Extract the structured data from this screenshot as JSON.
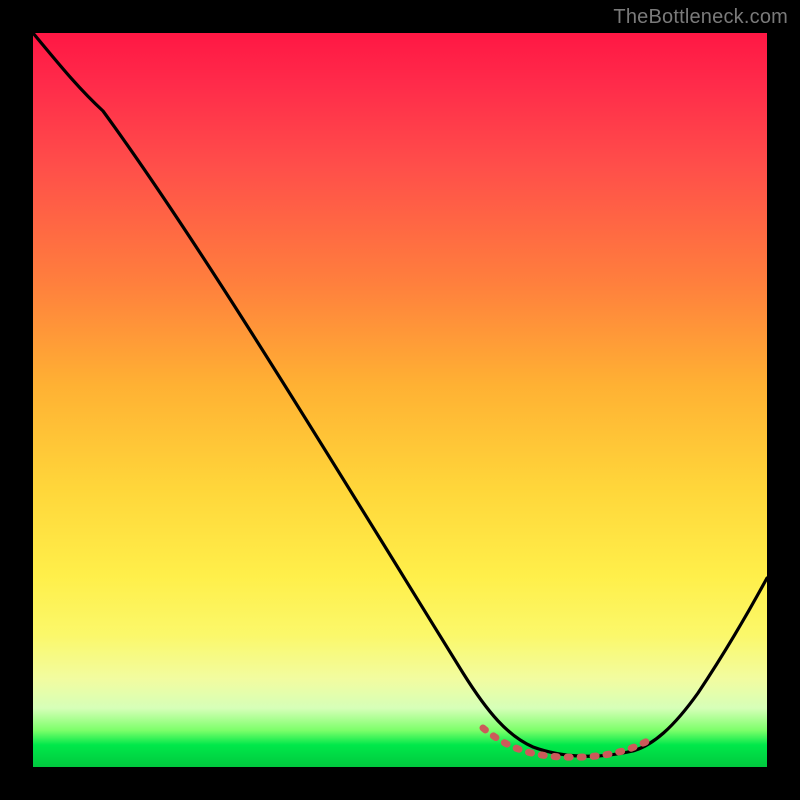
{
  "watermark": "TheBottleneck.com",
  "colors": {
    "frame": "#000000",
    "curve_main": "#000000",
    "curve_accent": "#cc5a5a",
    "gradient_top": "#ff1744",
    "gradient_mid": "#ffd63a",
    "gradient_bottom": "#00c93e"
  },
  "chart_data": {
    "type": "line",
    "title": "",
    "xlabel": "",
    "ylabel": "",
    "xlim": [
      0,
      100
    ],
    "ylim": [
      0,
      100
    ],
    "grid": false,
    "legend": false,
    "series": [
      {
        "name": "bottleneck-curve",
        "x": [
          0,
          5,
          10,
          15,
          20,
          25,
          30,
          35,
          40,
          45,
          50,
          55,
          60,
          63,
          66,
          70,
          74,
          78,
          82,
          86,
          90,
          94,
          100
        ],
        "y": [
          100,
          96,
          91,
          83,
          75,
          67,
          59,
          51,
          43,
          35,
          27,
          19,
          11,
          7,
          4,
          2,
          1.5,
          1.5,
          2,
          4,
          8,
          14,
          26
        ]
      },
      {
        "name": "accent-segment",
        "x": [
          62,
          66,
          70,
          74,
          78,
          82,
          84
        ],
        "y": [
          6,
          3.5,
          2.2,
          1.8,
          1.8,
          2.5,
          4
        ]
      }
    ],
    "annotations": []
  }
}
